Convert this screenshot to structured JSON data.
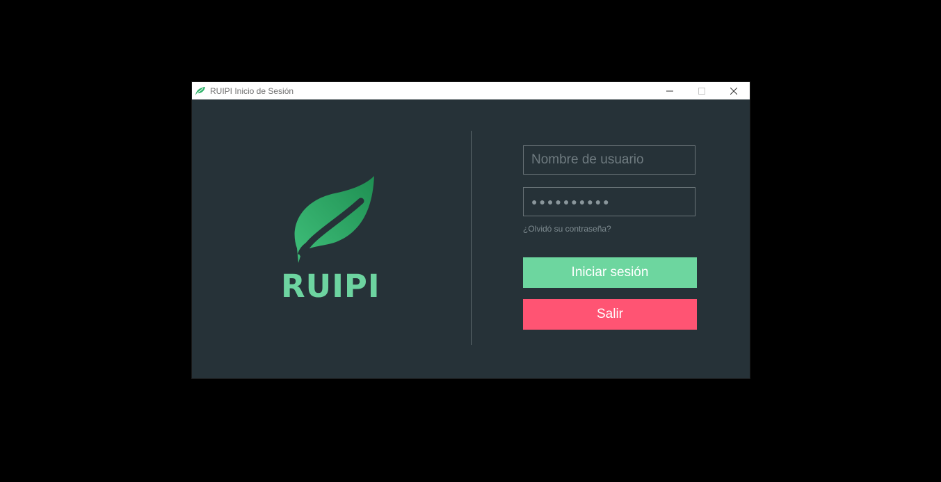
{
  "window": {
    "title": "RUIPI Inicio de Sesión"
  },
  "logo": {
    "text": "RUIPI",
    "icon": "leaf-icon"
  },
  "login": {
    "username_placeholder": "Nombre de usuario",
    "username_value": "",
    "password_value": "●●●●●●●●●●",
    "forgot_label": "¿Olvidó su contraseña?",
    "login_label": "Iniciar sesión",
    "exit_label": "Salir"
  },
  "colors": {
    "background": "#263238",
    "accent": "#6dd69f",
    "danger": "#ff5473"
  }
}
